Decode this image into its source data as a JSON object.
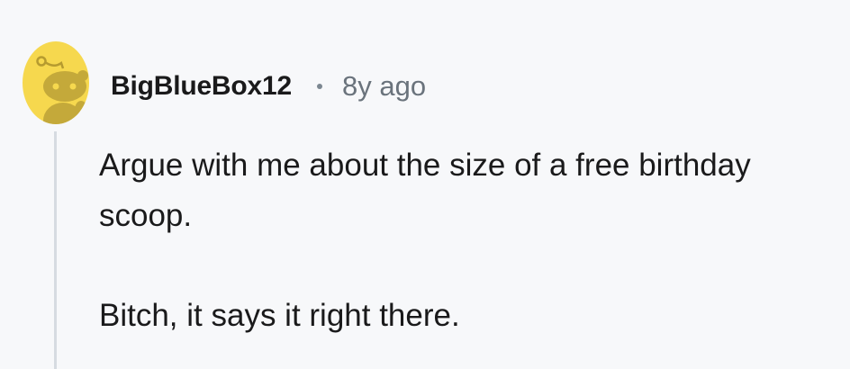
{
  "comment": {
    "username": "BigBlueBox12",
    "separator_icon": "dot-separator",
    "timestamp": "8y ago",
    "avatar_icon": "snoo-avatar-icon",
    "avatar_color": "#f6d84e",
    "paragraphs": [
      "Argue with me about the size of a free birthday scoop.",
      "Bitch, it says it right there."
    ]
  }
}
